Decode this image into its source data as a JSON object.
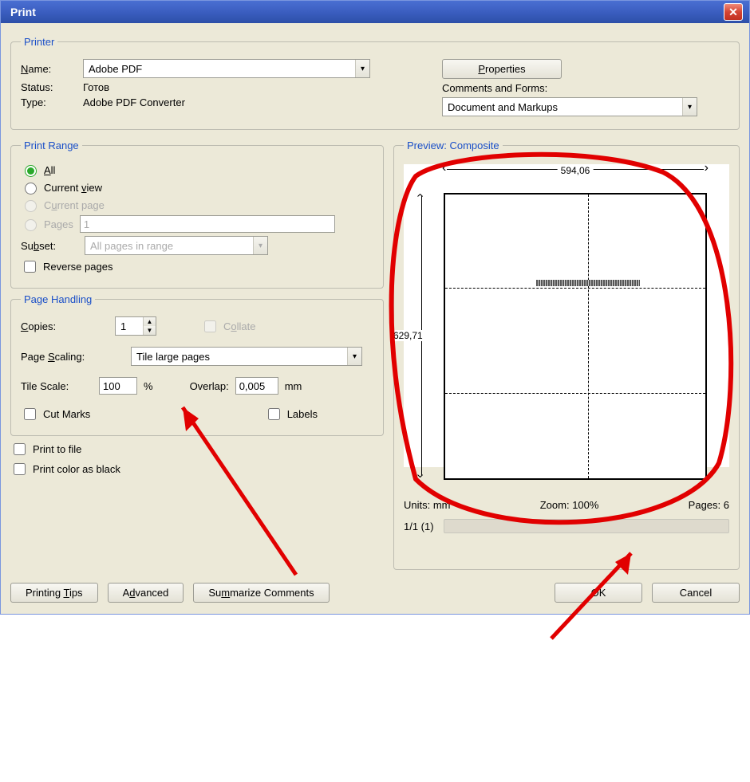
{
  "titlebar": {
    "title": "Print"
  },
  "printer": {
    "legend": "Printer",
    "name_label": "Name:",
    "name_value": "Adobe PDF",
    "properties_btn": "Properties",
    "status_label": "Status:",
    "status_value": "Готов",
    "type_label": "Type:",
    "type_value": "Adobe PDF Converter",
    "comments_label": "Comments and Forms:",
    "comments_value": "Document and Markups"
  },
  "print_range": {
    "legend": "Print Range",
    "all": "All",
    "current_view": "Current view",
    "current_page": "Current page",
    "pages": "Pages",
    "pages_value": "1",
    "subset_label": "Subset:",
    "subset_value": "All pages in range",
    "reverse": "Reverse pages"
  },
  "page_handling": {
    "legend": "Page Handling",
    "copies_label": "Copies:",
    "copies_value": "1",
    "collate": "Collate",
    "scaling_label": "Page Scaling:",
    "scaling_value": "Tile large pages",
    "tile_scale_label": "Tile Scale:",
    "tile_scale_value": "100",
    "tile_scale_unit": "%",
    "overlap_label": "Overlap:",
    "overlap_value": "0,005",
    "overlap_unit": "mm",
    "cut_marks": "Cut Marks",
    "labels": "Labels"
  },
  "misc": {
    "print_to_file": "Print to file",
    "print_color_black": "Print color as black"
  },
  "preview": {
    "legend": "Preview: Composite",
    "width_label": "594,06",
    "height_label": "629,71",
    "units": "Units: mm",
    "zoom": "Zoom: 100%",
    "pages": "Pages: 6",
    "pager": "1/1 (1)"
  },
  "buttons": {
    "printing_tips": "Printing Tips",
    "advanced": "Advanced",
    "summarize": "Summarize Comments",
    "ok": "OK",
    "cancel": "Cancel"
  }
}
